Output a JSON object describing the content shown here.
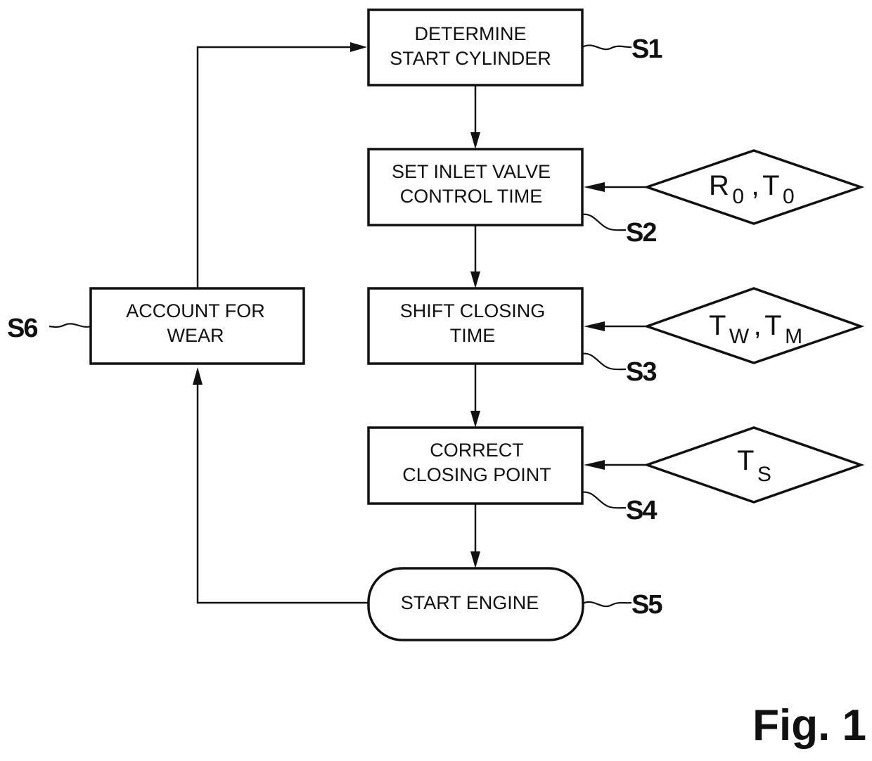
{
  "figure": {
    "label": "Fig. 1"
  },
  "steps": [
    {
      "id": "S1",
      "ref": "S1",
      "lines": [
        "DETERMINE",
        "START CYLINDER"
      ],
      "shape": "rectangle"
    },
    {
      "id": "S2",
      "ref": "S2",
      "lines": [
        "SET INLET VALVE",
        "CONTROL TIME"
      ],
      "shape": "rectangle"
    },
    {
      "id": "S3",
      "ref": "S3",
      "lines": [
        "SHIFT CLOSING",
        "TIME"
      ],
      "shape": "rectangle"
    },
    {
      "id": "S4",
      "ref": "S4",
      "lines": [
        "CORRECT",
        "CLOSING POINT"
      ],
      "shape": "rectangle"
    },
    {
      "id": "S5",
      "ref": "S5",
      "lines": [
        "START ENGINE"
      ],
      "shape": "terminal"
    },
    {
      "id": "S6",
      "ref": "S6",
      "lines": [
        "ACCOUNT FOR",
        "WEAR"
      ],
      "shape": "rectangle"
    }
  ],
  "inputs": [
    {
      "target": "S2",
      "shape": "diamond",
      "terms": [
        {
          "base": "R",
          "sub": "0"
        },
        {
          "base": "T",
          "sub": "0"
        }
      ],
      "separator": ","
    },
    {
      "target": "S3",
      "shape": "diamond",
      "terms": [
        {
          "base": "T",
          "sub": "W"
        },
        {
          "base": "T",
          "sub": "M"
        }
      ],
      "separator": ","
    },
    {
      "target": "S4",
      "shape": "diamond",
      "terms": [
        {
          "base": "T",
          "sub": "S"
        }
      ],
      "separator": ""
    }
  ],
  "edges": [
    {
      "from": "S1",
      "to": "S2"
    },
    {
      "from": "S2",
      "to": "S3"
    },
    {
      "from": "S3",
      "to": "S4"
    },
    {
      "from": "S4",
      "to": "S5"
    },
    {
      "from": "S5",
      "to": "S6"
    },
    {
      "from": "S6",
      "to": "S1"
    }
  ]
}
